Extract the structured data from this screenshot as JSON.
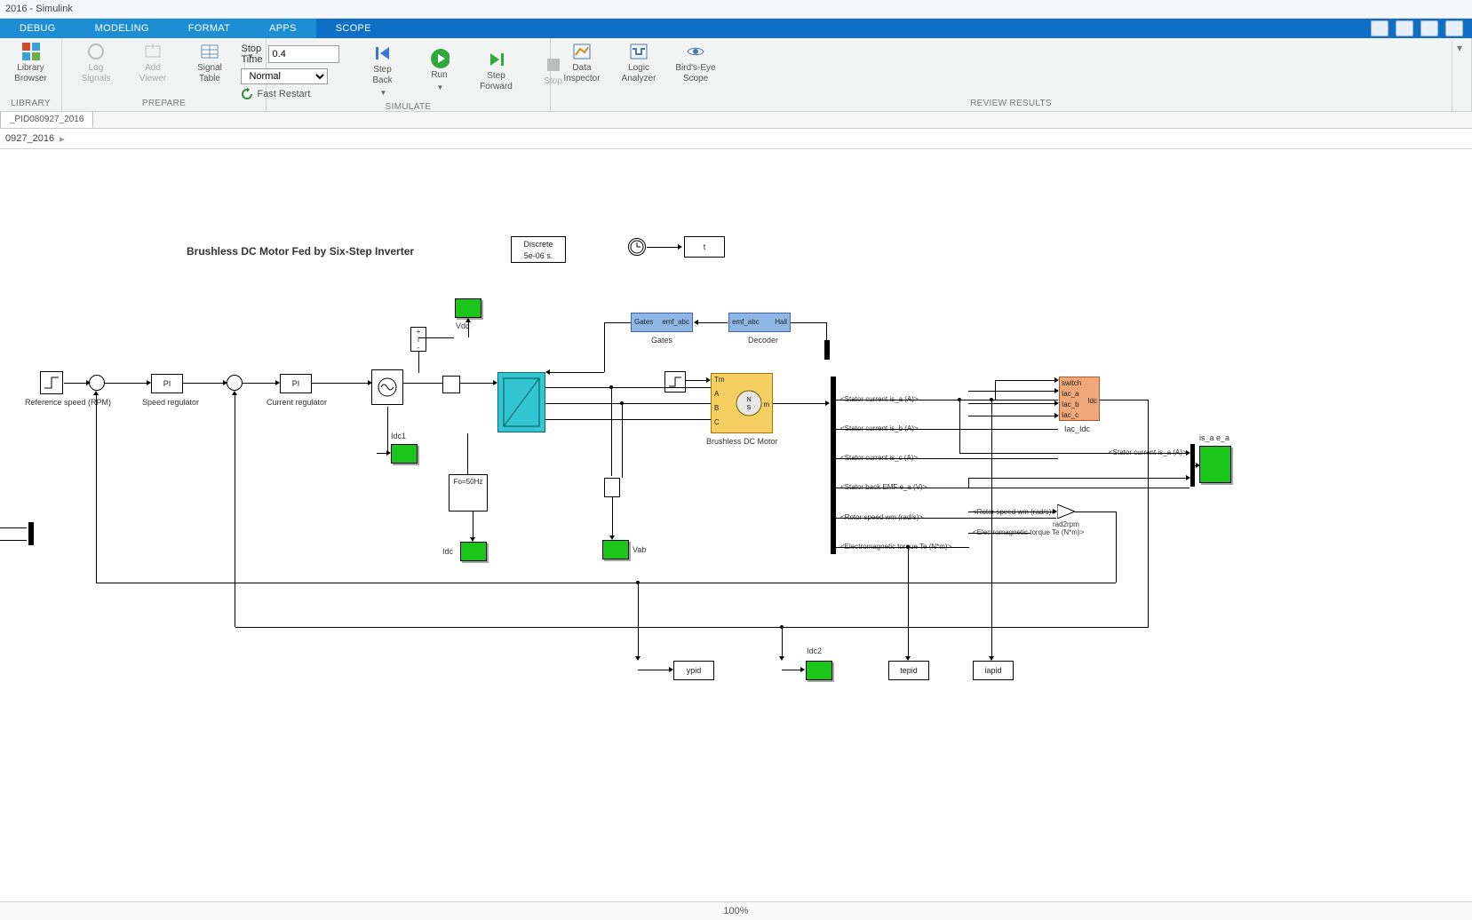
{
  "title": "2016 - Simulink",
  "tabs": [
    "DEBUG",
    "MODELING",
    "FORMAT",
    "APPS",
    "SCOPE"
  ],
  "activeTab": 4,
  "ribbon": {
    "library": {
      "label": "Library\nBrowser",
      "group": "LIBRARY"
    },
    "prepare": {
      "group": "PREPARE",
      "log": "Log\nSignals",
      "addviewer": "Add\nViewer",
      "sigtable": "Signal\nTable"
    },
    "simulate": {
      "group": "SIMULATE",
      "stoptime_label": "Stop Time",
      "stoptime_value": "0.4",
      "mode": "Normal",
      "fastrestart": "Fast Restart",
      "stepback": "Step\nBack",
      "run": "Run",
      "stepfwd": "Step\nForward",
      "stop": "Stop"
    },
    "review": {
      "group": "REVIEW RESULTS",
      "dinspect": "Data\nInspector",
      "logican": "Logic\nAnalyzer",
      "birdseye": "Bird's-Eye\nScope"
    }
  },
  "doctab": "_PID080927_2016",
  "crumb": "0927_2016",
  "canvas": {
    "title": "Brushless DC Motor Fed by Six-Step Inverter",
    "powergui": "Discrete\n5e-06 s.",
    "t": "t",
    "refspeed": "Reference\nspeed (RPM)",
    "speedreg": "Speed\nregulator",
    "curreg": "Current\nregulator",
    "pi": "PI",
    "vdc": "Vdc",
    "idc": "Idc",
    "idc1": "Idc1",
    "idc2": "Idc2",
    "vab": "Vab",
    "gates": "Gates",
    "gates_in": "Gates",
    "gates_out": "emf_abc",
    "decoder": "Decoder",
    "dec_in": "emf_abc",
    "dec_out": "Hall",
    "fo": "Fo=50Hz",
    "bldc": "Brushless DC Motor",
    "bldc_ports": {
      "tm": "Tm",
      "a": "A",
      "b": "B",
      "c": "C",
      "m": "m"
    },
    "switchbox": {
      "sw": "switch",
      "a": "Iac_a",
      "b": "Iac_b",
      "c": "Iac_c",
      "out": "Idc"
    },
    "iacidc": "Iac_Idc",
    "ypid": "ypid",
    "tepid": "tepid",
    "iapid": "iapid",
    "isaea": "is_a e_a",
    "rad2rpm": "rad2rpm",
    "signals": {
      "isa": "<Stator current is_a (A)>",
      "isb": "<Stator current is_b (A)>",
      "isc": "<Stator current is_c (A)>",
      "emf_ea": "<Stator back EMF e_a (V)>",
      "wm": "<Rotor speed wm (rad/s)>",
      "te": "<Electromagnetic torque Te (N*m)>",
      "isa2": "<Stator current is_a (A)>",
      "wm2": "<Rotor speed wm (rad/s)>",
      "te2": "<Electromagnetic torque Te (N*m)>"
    }
  },
  "status": {
    "zoom": "100%"
  }
}
